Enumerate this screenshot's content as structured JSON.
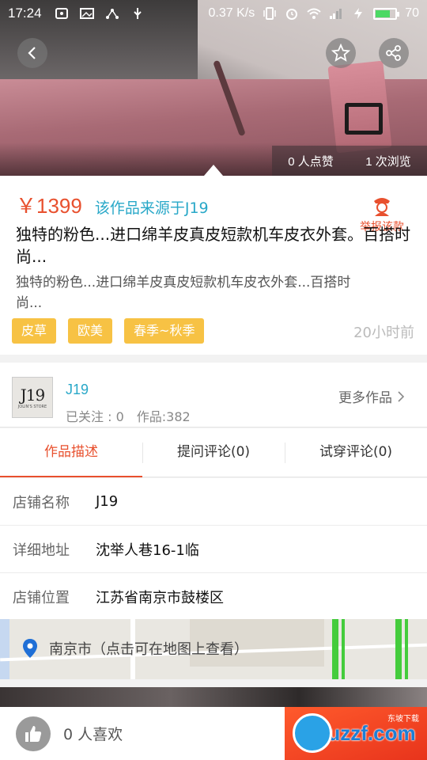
{
  "status_bar": {
    "time": "17:24",
    "net_speed": "0.37 K/s",
    "network_type": "4G",
    "battery": "70"
  },
  "hero": {
    "likes": "0 人点赞",
    "views": "1 次浏览"
  },
  "product": {
    "price": "￥1399",
    "source": "该作品来源于J19",
    "report_label": "举报该款",
    "title": "独特的粉色...进口绵羊皮真皮短款机车皮衣外套。百搭时尚...",
    "subtitle": "独特的粉色...进口绵羊皮真皮短款机车皮衣外套...百搭时尚...",
    "tags": [
      "皮草",
      "欧美",
      "春季~秋季"
    ],
    "time_ago": "20小时前"
  },
  "store": {
    "logo_mono": "J19",
    "logo_sub": "JOLIN'S STORE",
    "name": "J19",
    "followers": "已关注 : 0",
    "works": "作品:382",
    "more": "更多作品"
  },
  "tabs": [
    "作品描述",
    "提问评论(0)",
    "试穿评论(0)"
  ],
  "details": [
    {
      "label": "店铺名称",
      "value": "J19"
    },
    {
      "label": "详细地址",
      "value": "沈举人巷16-1临"
    },
    {
      "label": "店铺位置",
      "value": "江苏省南京市鼓楼区"
    }
  ],
  "map": {
    "label": "南京市（点击可在地图上查看）"
  },
  "bottom": {
    "likes": "0 人喜欢",
    "watermark": "uzzf.com",
    "watermark_small": "东坡下载"
  },
  "colors": {
    "accent_red": "#e8502e",
    "accent_blue": "#29a8c8",
    "tag_yellow": "#f7c244"
  }
}
